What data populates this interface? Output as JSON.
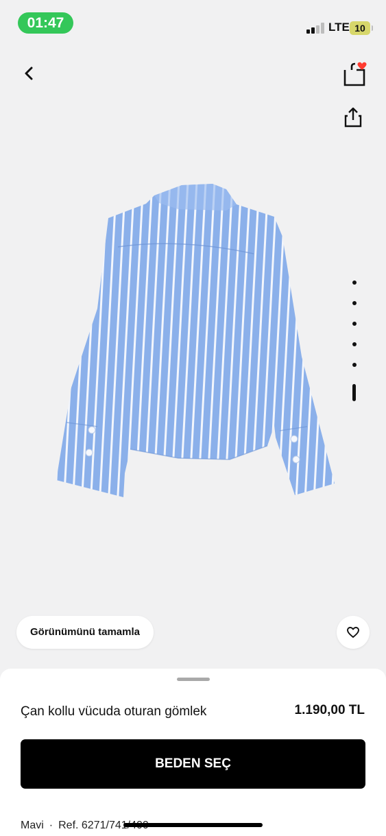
{
  "status_bar": {
    "time": "01:47",
    "network": "LTE",
    "battery": "10",
    "colors": {
      "time_pill": "#34c759",
      "battery": "#d7d76b"
    }
  },
  "header": {
    "icons": {
      "back": "chevron-left-icon",
      "bag": "shopping-bag-icon",
      "share": "share-icon"
    },
    "bag_badge_color": "#ff3b30"
  },
  "gallery": {
    "image": "blue-white-striped-shirt-back-view",
    "page_count": 6,
    "active_index": 5
  },
  "actions": {
    "complete_look_label": "Görünümünü tamamla",
    "favorite_icon": "heart-icon"
  },
  "product": {
    "name": "Çan kollu vücuda oturan gömlek",
    "price": "1.190,00 TL",
    "size_button_label": "BEDEN SEÇ",
    "color": "Mavi",
    "separator": "·",
    "reference": "Ref. 6271/741/400"
  }
}
